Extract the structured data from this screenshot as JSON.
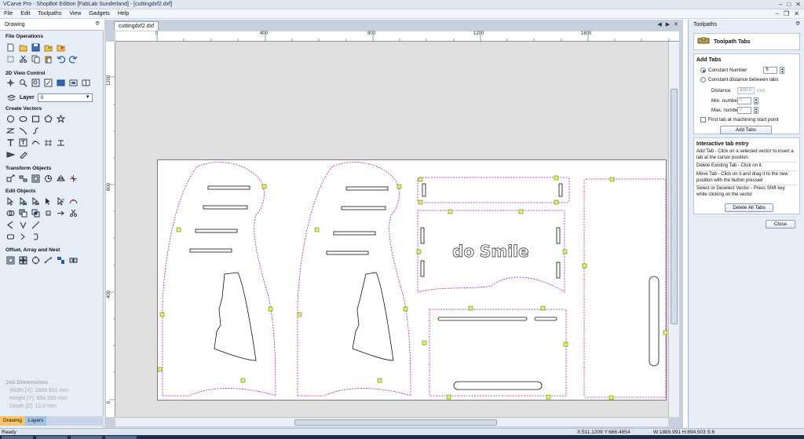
{
  "window": {
    "title": "VCarve Pro - ShopBot Edition [FabLab Sunderland] - [cuttingdxf2.dxf]"
  },
  "menu": [
    "File",
    "Edit",
    "Toolpaths",
    "View",
    "Gadgets",
    "Help"
  ],
  "left_panel": {
    "title": "Drawing",
    "sections": {
      "file_operations": "File Operations",
      "view_control": "2D View Control",
      "create_vectors": "Create Vectors",
      "transform_objects": "Transform Objects",
      "edit_objects": "Edit Objects",
      "offset_array_nest": "Offset, Array and Nest"
    },
    "layer_label": "Layer",
    "layer_value": "0",
    "job_dimensions": {
      "heading": "Job Dimensions",
      "width": "Width  [X]: 1889.991 mm",
      "height": "Height [Y]: 894.583 mm",
      "depth": "Depth  [Z]: 12.0 mm"
    },
    "tabs": [
      "Drawing",
      "Layers"
    ]
  },
  "document": {
    "tab": "cuttingdxf2.dxf",
    "ruler_top": [
      "0",
      "400",
      "800",
      "1200",
      "1600"
    ],
    "ruler_left": [
      "1200",
      "800",
      "400",
      "0"
    ],
    "text_on_canvas": "do Smile"
  },
  "right_panel": {
    "title": "Toolpaths",
    "header": "Toolpath Tabs",
    "add_tabs": {
      "heading": "Add Tabs",
      "constant_number_label": "Constant Number",
      "constant_number_value": "6",
      "constant_distance_label": "Constant distance between tabs",
      "distance_label": "Distance",
      "distance_value": "200.0",
      "distance_unit": "mm",
      "min_number_label": "Min. number",
      "min_number_value": "0",
      "max_number_label": "Max. number",
      "max_number_value": "0",
      "first_tab_label": "First tab at machining start point",
      "add_button": "Add Tabs"
    },
    "interactive": {
      "heading": "Interactive tab entry",
      "add_text": "Add Tab - Click on a selected vector to insert a tab at the cursor position.",
      "delete_text": "Delete Existing Tab - Click on it.",
      "move_text": "Move Tab - Click on it and drag it to the new position with the button pressed",
      "select_text": "Select or Deselect Vector - Press Shift key while clicking on the vector",
      "delete_all_button": "Delete All Tabs"
    },
    "close_button": "Close"
  },
  "status": {
    "ready": "Ready",
    "coords": "X:511.1209 Y:666.4854",
    "dims": "W:1889.991  H:894.503  S:6"
  }
}
